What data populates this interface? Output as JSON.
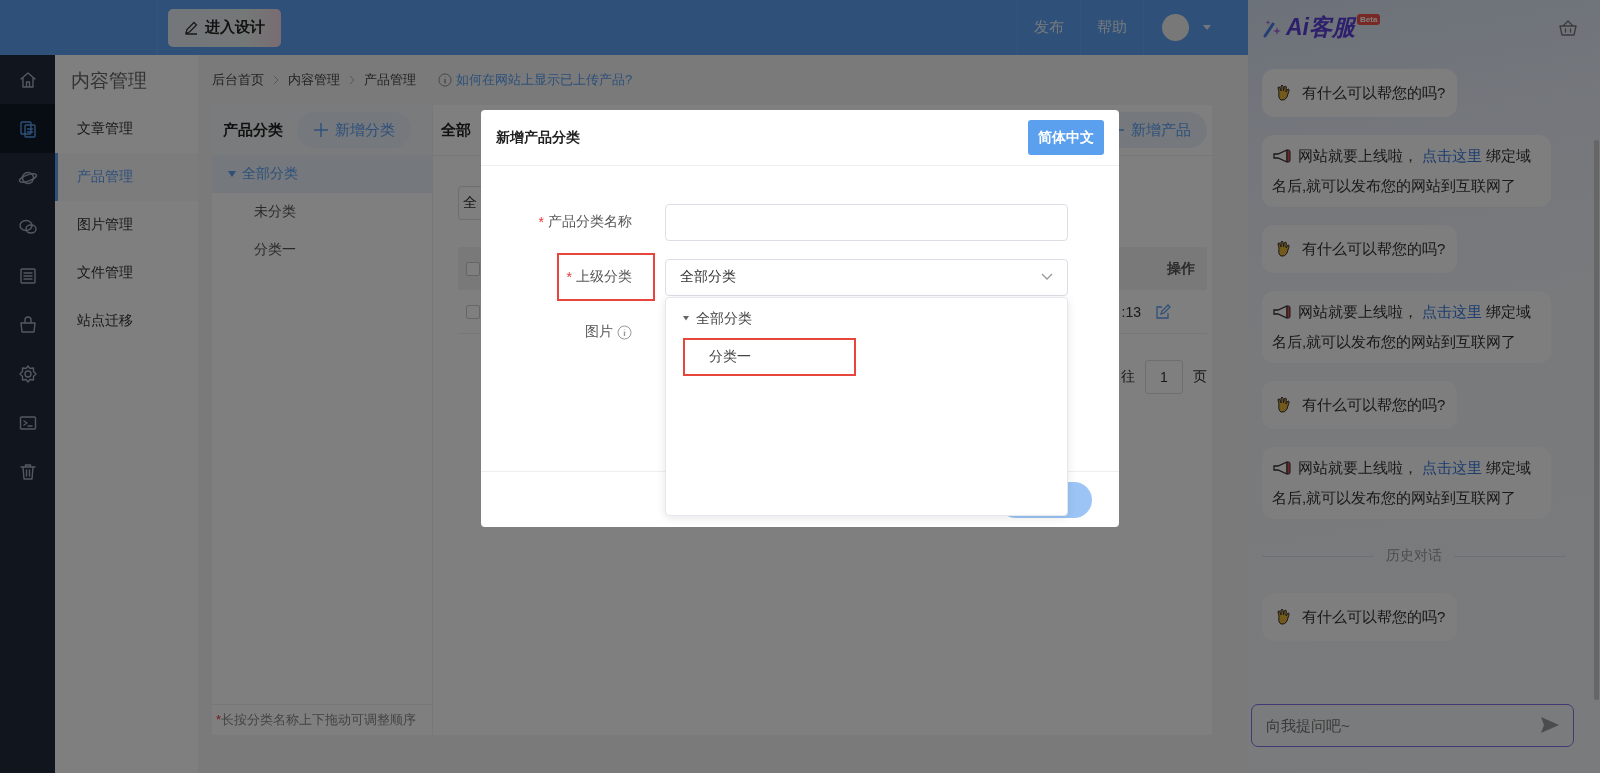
{
  "header": {
    "design_button": "进入设计",
    "nav": [
      "发布",
      "帮助"
    ]
  },
  "icon_rail": [
    {
      "selected": false
    },
    {
      "selected": true
    },
    {
      "selected": false
    },
    {
      "selected": false
    },
    {
      "selected": false
    },
    {
      "selected": false
    },
    {
      "selected": false
    },
    {
      "selected": false
    },
    {
      "selected": false
    }
  ],
  "submenu": {
    "title": "内容管理",
    "items": [
      {
        "label": "文章管理",
        "selected": false
      },
      {
        "label": "产品管理",
        "selected": true
      },
      {
        "label": "图片管理",
        "selected": false
      },
      {
        "label": "文件管理",
        "selected": false
      },
      {
        "label": "站点迁移",
        "selected": false
      }
    ]
  },
  "breadcrumb": {
    "items": [
      "后台首页",
      "内容管理",
      "产品管理"
    ],
    "help_link": "如何在网站上显示已上传产品?"
  },
  "category_panel": {
    "title": "产品分类",
    "add_button": "新增分类",
    "tree": [
      {
        "label": "全部分类",
        "selected": true,
        "expanded": true,
        "children": [
          {
            "label": "未分类",
            "selected": false
          },
          {
            "label": "分类一",
            "selected": false
          }
        ]
      }
    ],
    "hint_mark": "*",
    "hint": "长按分类名称上下拖动可调整顺序"
  },
  "product_panel": {
    "title": "全部",
    "add_button": "新增产品",
    "filter": "全",
    "table": {
      "header_checked": false,
      "actions_column": "操作",
      "rows": [
        {
          "checked": false,
          "time": ":13"
        }
      ]
    },
    "pagination": {
      "goto": "往",
      "page": "1",
      "unit": "页"
    }
  },
  "dialog": {
    "title": "新增产品分类",
    "language_button": "简体中文",
    "fields": [
      {
        "kind": "text",
        "label": "产品分类名称",
        "required": true,
        "highlighted": false
      },
      {
        "kind": "select",
        "label": "上级分类",
        "required": true,
        "highlighted": true,
        "value": "全部分类"
      },
      {
        "kind": "image",
        "label": "图片",
        "required": false,
        "highlighted": false
      }
    ],
    "dropdown": {
      "tree": [
        {
          "label": "全部分类",
          "expanded": true,
          "highlighted": false,
          "children": [
            {
              "label": "分类一",
              "highlighted": true
            }
          ]
        }
      ]
    }
  },
  "chat": {
    "logo": "Ai客服",
    "badge": "Beta",
    "messages": [
      {
        "kind": "greeting",
        "text": "有什么可以帮您的吗?"
      },
      {
        "kind": "notice",
        "text_before": "网站就要上线啦，",
        "link": "点击这里",
        "text_after": "绑定域名后,就可以发布您的网站到互联网了"
      },
      {
        "kind": "greeting",
        "text": "有什么可以帮您的吗?"
      },
      {
        "kind": "notice",
        "text_before": "网站就要上线啦，",
        "link": "点击这里",
        "text_after": "绑定域名后,就可以发布您的网站到互联网了"
      },
      {
        "kind": "greeting",
        "text": "有什么可以帮您的吗?"
      },
      {
        "kind": "notice",
        "text_before": "网站就要上线啦，",
        "link": "点击这里",
        "text_after": "绑定域名后,就可以发布您的网站到互联网了"
      },
      {
        "kind": "divider",
        "text": "历史对话"
      },
      {
        "kind": "greeting",
        "text": "有什么可以帮您的吗?"
      }
    ],
    "input": {
      "placeholder": "向我提问吧~"
    }
  }
}
